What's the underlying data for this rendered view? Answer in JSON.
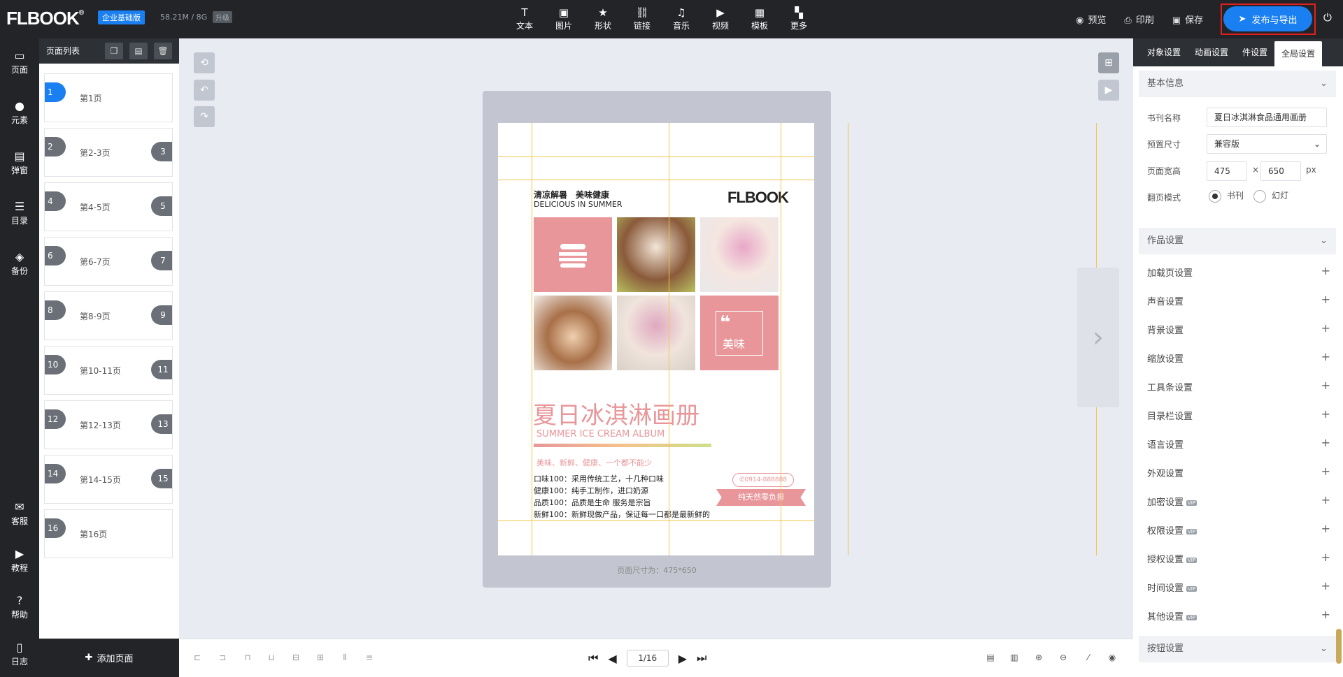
{
  "header": {
    "logo": "FLBOOK",
    "logo_mark": "®",
    "edition": "企业基础版",
    "storage": "58.21M / 8G",
    "upgrade": "升级",
    "tools": [
      {
        "label": "文本",
        "icon": "text-icon",
        "glyph": "T"
      },
      {
        "label": "图片",
        "icon": "image-icon",
        "glyph": "▣"
      },
      {
        "label": "形状",
        "icon": "star-icon",
        "glyph": "★"
      },
      {
        "label": "链接",
        "icon": "link-icon",
        "glyph": "⛓"
      },
      {
        "label": "音乐",
        "icon": "music-icon",
        "glyph": "♫"
      },
      {
        "label": "视频",
        "icon": "video-icon",
        "glyph": "▶"
      },
      {
        "label": "模板",
        "icon": "template-icon",
        "glyph": "▦"
      },
      {
        "label": "更多",
        "icon": "more-icon",
        "glyph": "▚"
      }
    ],
    "preview": "预览",
    "print": "印刷",
    "save": "保存",
    "publish": "发布与导出"
  },
  "leftnav": [
    {
      "label": "页面",
      "icon": "page-icon",
      "glyph": "▭"
    },
    {
      "label": "元素",
      "icon": "elements-icon",
      "glyph": "●"
    },
    {
      "label": "弹窗",
      "icon": "popup-icon",
      "glyph": "▤"
    },
    {
      "label": "目录",
      "icon": "toc-icon",
      "glyph": "☰"
    },
    {
      "label": "备份",
      "icon": "backup-icon",
      "glyph": "◈"
    },
    {
      "label": "客服",
      "icon": "service-icon",
      "glyph": "✉"
    },
    {
      "label": "教程",
      "icon": "tutorial-icon",
      "glyph": "▶"
    },
    {
      "label": "帮助",
      "icon": "help-icon",
      "glyph": "?"
    },
    {
      "label": "日志",
      "icon": "log-icon",
      "glyph": "▯"
    }
  ],
  "pagepanel": {
    "title": "页面列表",
    "pages": [
      {
        "left": "1",
        "right": "",
        "label": "第1页",
        "active": true
      },
      {
        "left": "2",
        "right": "3",
        "label": "第2-3页"
      },
      {
        "left": "4",
        "right": "5",
        "label": "第4-5页"
      },
      {
        "left": "6",
        "right": "7",
        "label": "第6-7页"
      },
      {
        "left": "8",
        "right": "9",
        "label": "第8-9页"
      },
      {
        "left": "10",
        "right": "11",
        "label": "第10-11页"
      },
      {
        "left": "12",
        "right": "13",
        "label": "第12-13页"
      },
      {
        "left": "14",
        "right": "15",
        "label": "第14-15页"
      },
      {
        "left": "16",
        "right": "",
        "label": "第16页"
      }
    ],
    "add_page": "添加页面"
  },
  "canvas": {
    "size_label": "页面尺寸为：475*650",
    "pager": "1/16",
    "title_cn": "清凉解暑　美味健康",
    "title_en": "DELICIOUS IN SUMMER",
    "brand": "FLBOOK",
    "tile_label": "美味",
    "headline": "夏日冰淇淋画册",
    "subheadline": "SUMMER ICE CREAM ALBUM",
    "slogan": "美味、新鲜、健康、一个都不能少",
    "features": [
      "口味100：采用传统工艺，十几种口味",
      "健康100：纯手工制作，进口奶源",
      "品质100：品质是生命 服务是宗旨",
      "新鲜100：新鲜现做产品，保证每一口都是最新鲜的"
    ],
    "phone": "✆0914-888888",
    "ribbon": "纯天然零负担"
  },
  "rightpanel": {
    "tabs": [
      "对象设置",
      "动画设置",
      "组件设置",
      "全局设置"
    ],
    "tab_display": [
      "对象设置",
      "动画设置",
      "件设置",
      "全局设置"
    ],
    "basic_title": "基本信息",
    "book_name_label": "书刊名称",
    "book_name": "夏日冰淇淋食品通用画册",
    "preset_label": "预置尺寸",
    "preset": "兼容版",
    "size_label": "页面宽高",
    "width": "475",
    "height": "650",
    "times": "×",
    "unit": "px",
    "flip_label": "翻页模式",
    "flip_book": "书刊",
    "flip_slide": "幻灯",
    "works_title": "作品设置",
    "settings": [
      {
        "label": "加载页设置",
        "vip": false
      },
      {
        "label": "声音设置",
        "vip": false
      },
      {
        "label": "背景设置",
        "vip": false
      },
      {
        "label": "缩放设置",
        "vip": false
      },
      {
        "label": "工具条设置",
        "vip": false
      },
      {
        "label": "目录栏设置",
        "vip": false
      },
      {
        "label": "语言设置",
        "vip": false
      },
      {
        "label": "外观设置",
        "vip": false
      },
      {
        "label": "加密设置",
        "vip": true
      },
      {
        "label": "权限设置",
        "vip": true
      },
      {
        "label": "授权设置",
        "vip": true
      },
      {
        "label": "时间设置",
        "vip": true
      },
      {
        "label": "其他设置",
        "vip": true
      }
    ],
    "vip_badge": "VIP",
    "button_title": "按钮设置"
  },
  "colors": {
    "accent": "#1a7ff0",
    "dark": "#222428",
    "pink": "#e8969a",
    "guide": "#f2c44a",
    "highlight": "#e02020"
  }
}
